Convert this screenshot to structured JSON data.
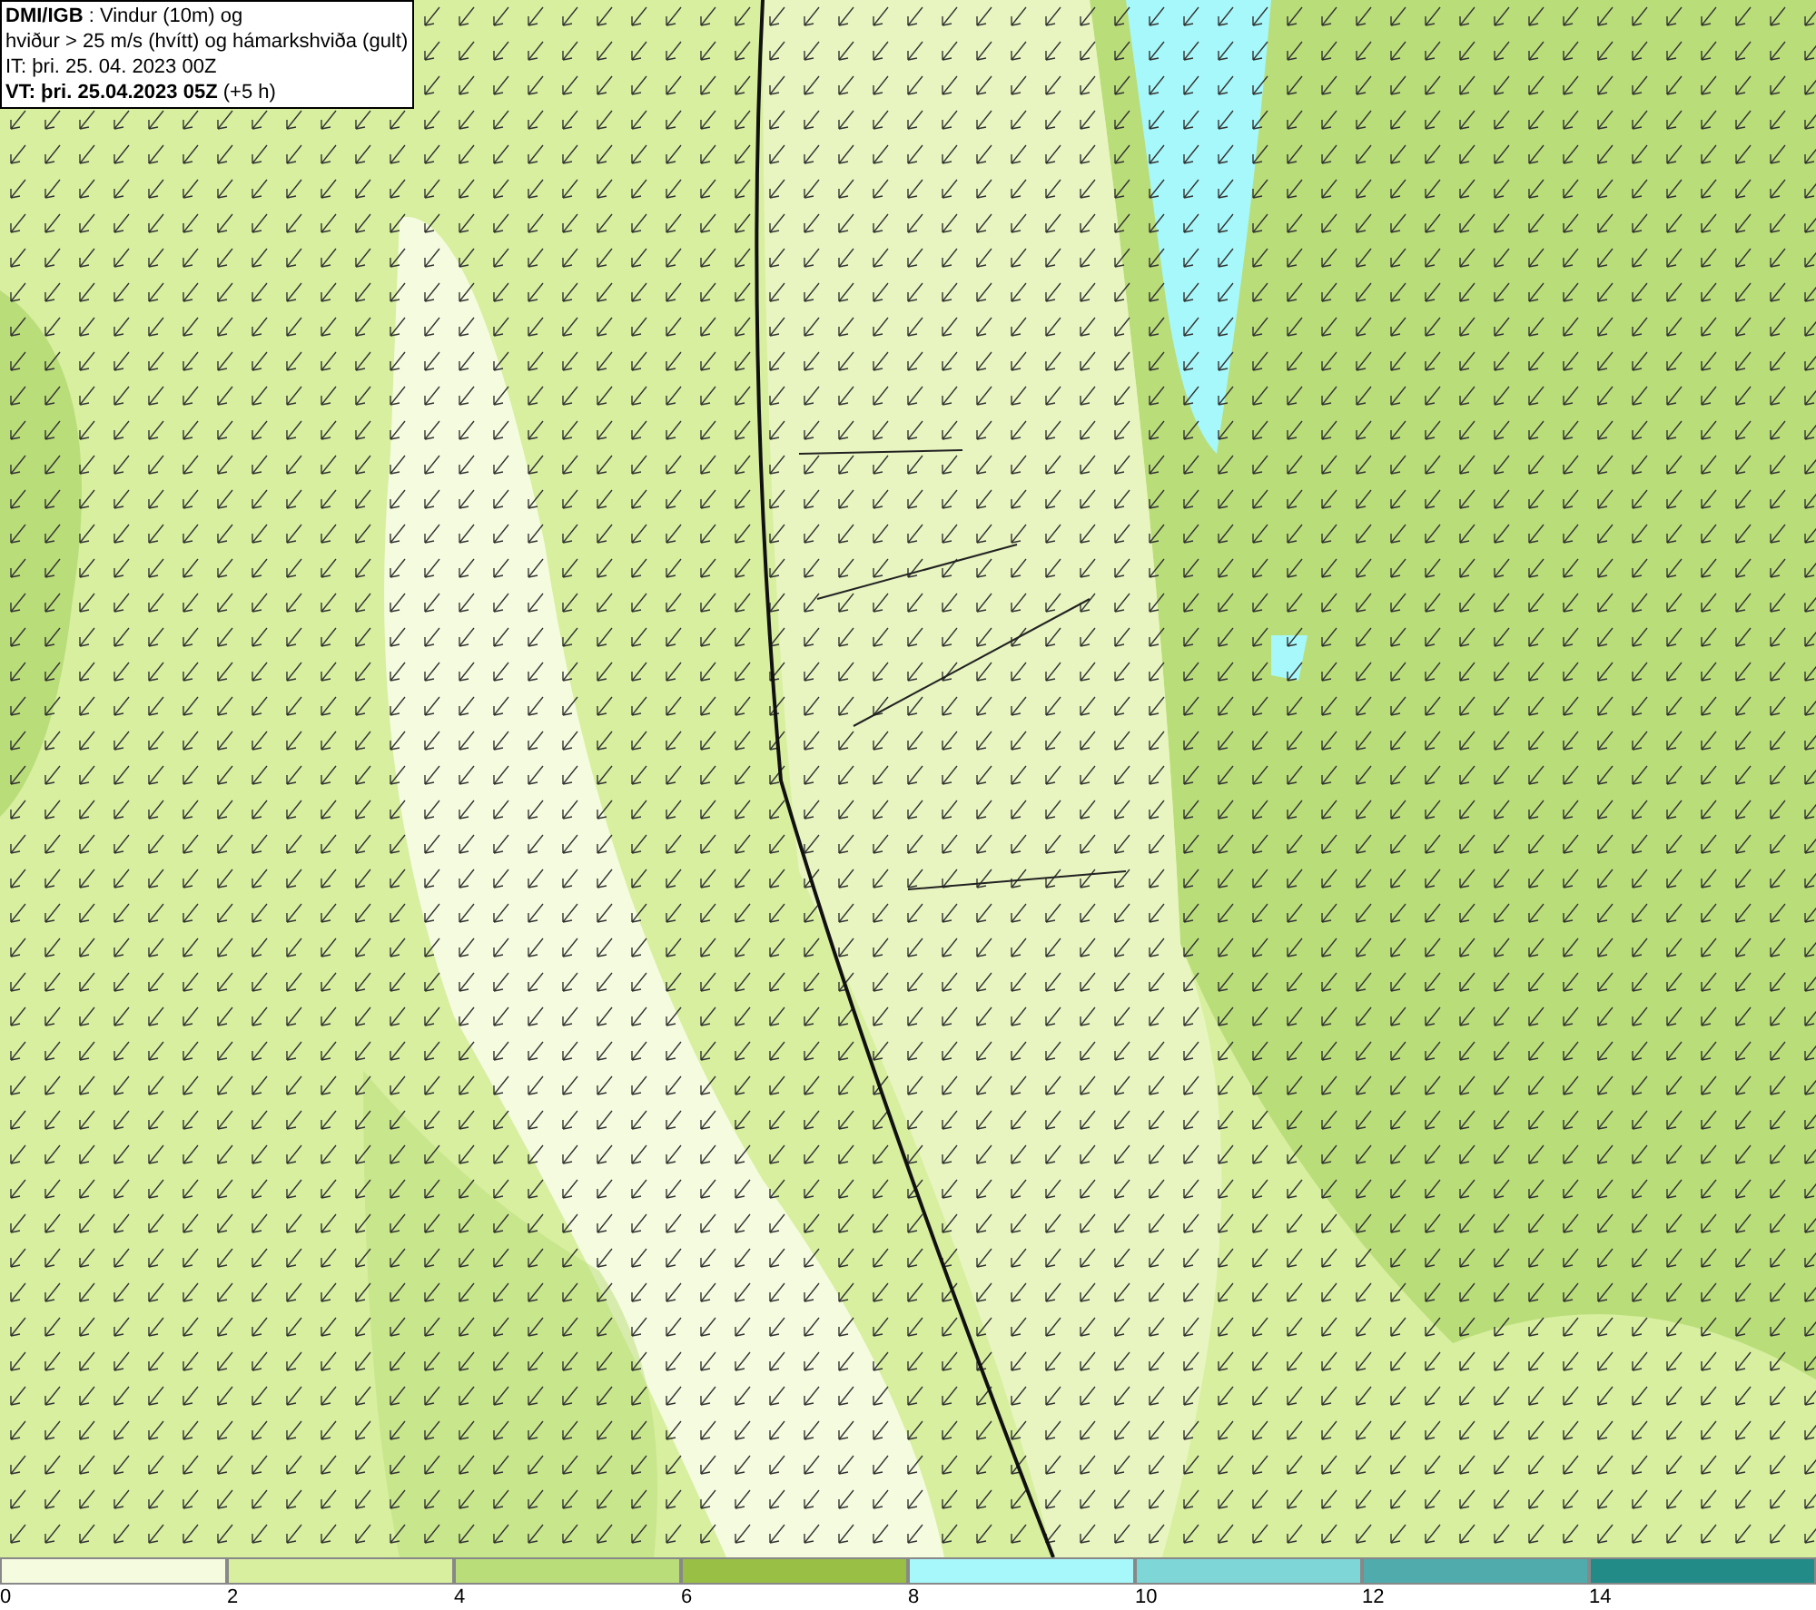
{
  "header": {
    "lines": [
      "**DMI/IGB** : Vindur (10m) og",
      "hviður > 25 m/s (hvítt) og hámarkshviða (gult)",
      "IT: þri. 25. 04. 2023 00Z",
      "**VT: þri. 25.04.2023 05Z** (+5 h)"
    ]
  },
  "scale": {
    "segments": [
      {
        "color": "#f5fbdf"
      },
      {
        "color": "#d7ef9f"
      },
      {
        "color": "#b9dd79"
      },
      {
        "color": "#99c045"
      },
      {
        "color": "#a6f8fa"
      },
      {
        "color": "#7fd6d6"
      },
      {
        "color": "#50acac"
      },
      {
        "color": "#228a87"
      }
    ],
    "ticks": [
      "0",
      "2",
      "4",
      "6",
      "8",
      "10",
      "12",
      "14"
    ]
  }
}
